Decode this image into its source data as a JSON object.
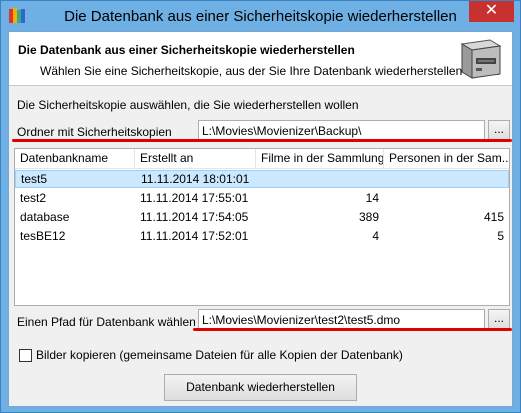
{
  "window": {
    "title": "Die Datenbank aus einer Sicherheitskopie wiederherstellen",
    "close_glyph": "✕"
  },
  "header": {
    "title": "Die Datenbank aus einer Sicherheitskopie wiederherstellen",
    "subtitle": "Wählen Sie eine Sicherheitskopie, aus der Sie Ihre Datenbank wiederherstellen wollen",
    "icon": "database-server-icon"
  },
  "section_label": "Die Sicherheitskopie auswählen, die Sie wiederherstellen wollen",
  "backup_folder": {
    "label": "Ordner mit Sicherheitskopien",
    "value": "L:\\Movies\\Movienizer\\Backup\\",
    "browse_label": "..."
  },
  "table": {
    "columns": [
      "Datenbankname",
      "Erstellt an",
      "Filme in der Sammlung",
      "Personen in der Sam..."
    ],
    "rows": [
      {
        "name": "test5",
        "created": "11.11.2014 18:01:01",
        "films": "",
        "persons": "",
        "selected": true
      },
      {
        "name": "test2",
        "created": "11.11.2014 17:55:01",
        "films": "14",
        "persons": "",
        "selected": false
      },
      {
        "name": "database",
        "created": "11.11.2014 17:54:05",
        "films": "389",
        "persons": "415",
        "selected": false
      },
      {
        "name": "tesBE12",
        "created": "11.11.2014 17:52:01",
        "films": "4",
        "persons": "5",
        "selected": false
      }
    ]
  },
  "db_path": {
    "label": "Einen Pfad für Datenbank wählen",
    "value": "L:\\Movies\\Movienizer\\test2\\test5.dmo",
    "browse_label": "..."
  },
  "copy_images": {
    "label": "Bilder kopieren (gemeinsame Dateien für alle Kopien der Datenbank)",
    "checked": false
  },
  "restore_button": "Datenbank wiederherstellen",
  "colors": {
    "titlebar": "#6fb0e4",
    "close": "#c7312f",
    "annotation_red": "#e00000",
    "selection": "#cce8ff"
  }
}
